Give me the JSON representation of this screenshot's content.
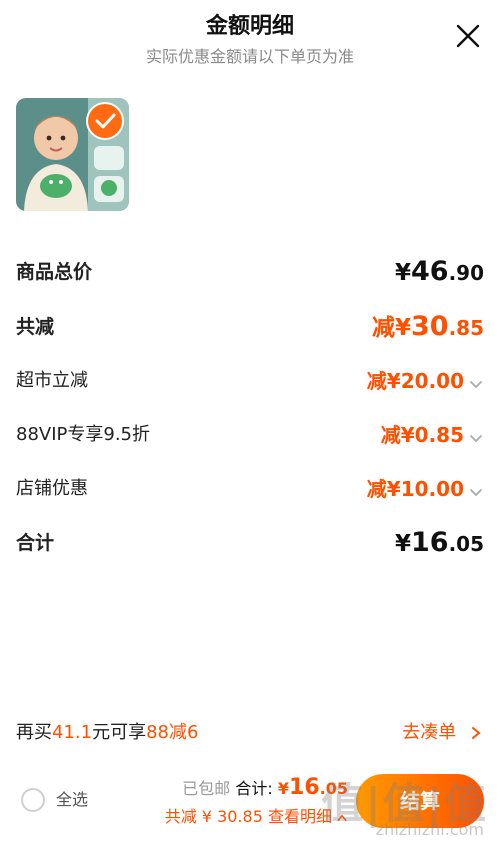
{
  "header": {
    "title": "金额明细",
    "subtitle": "实际优惠金额请以下单页为准"
  },
  "rows": [
    {
      "label": "商品总价",
      "prefix": "",
      "currency": "¥",
      "int": "46",
      "dec": ".90",
      "emph": false,
      "bold": true,
      "arrow": false
    },
    {
      "label": "共减",
      "prefix": "减",
      "currency": "¥",
      "int": "30",
      "dec": ".85",
      "emph": true,
      "bold": true,
      "arrow": false
    },
    {
      "label": "超市立减",
      "prefix": "减",
      "currency": "¥",
      "int": "20",
      "dec": ".00",
      "emph": true,
      "bold": false,
      "arrow": true
    },
    {
      "label": "88VIP专享9.5折",
      "prefix": "减",
      "currency": "¥",
      "int": "0",
      "dec": ".85",
      "emph": true,
      "bold": false,
      "arrow": true
    },
    {
      "label": "店铺优惠",
      "prefix": "减",
      "currency": "¥",
      "int": "10",
      "dec": ".00",
      "emph": true,
      "bold": false,
      "arrow": true
    },
    {
      "label": "合计",
      "prefix": "",
      "currency": "¥",
      "int": "16",
      "dec": ".05",
      "emph": false,
      "bold": true,
      "arrow": false
    }
  ],
  "promo": {
    "text_a": "再买",
    "amount": "41.1",
    "text_b": "元可享",
    "deal": "88减6",
    "action": "去凑单"
  },
  "bottom": {
    "select_all": "全选",
    "shipping": "已包邮",
    "total_label": "合计:",
    "total_currency": "¥",
    "total_int": "16",
    "total_dec": ".05",
    "discount_text": "共减 ¥ 30.85",
    "details_label": "查看明细",
    "checkout_label": "结算"
  },
  "watermark": {
    "cn": "值|值|值",
    "en": "zhizhizhi.com"
  },
  "colors": {
    "accent": "#ff5000",
    "checkout_gradient": [
      "#ff9a00",
      "#ff5000"
    ],
    "thumb_bg": "#5d8f8a"
  }
}
